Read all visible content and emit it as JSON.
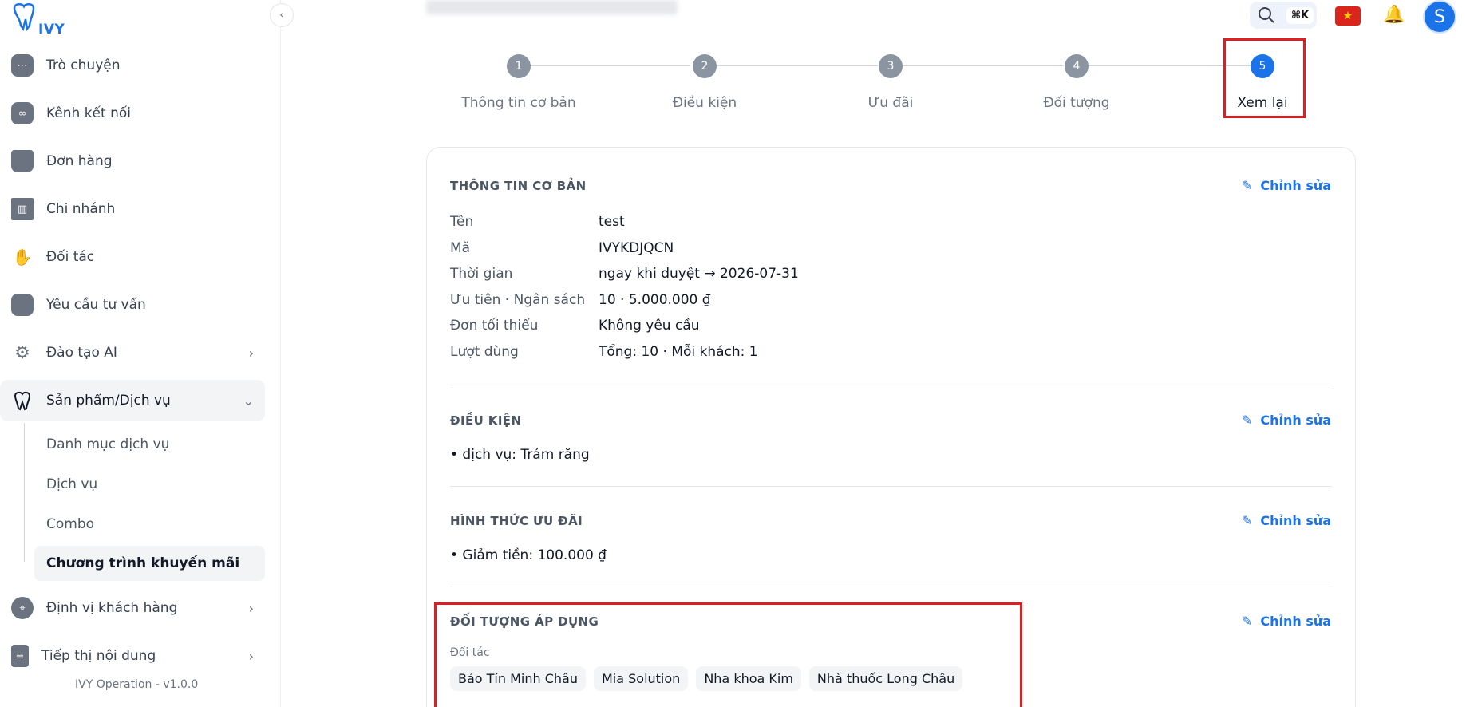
{
  "sidebar": {
    "logo_text": "IVY",
    "collapse_icon": "chevron-left-icon",
    "items": [
      {
        "label": "Trò chuyện",
        "icon": "chat-icon"
      },
      {
        "label": "Kênh kết nối",
        "icon": "link-icon"
      },
      {
        "label": "Đơn hàng",
        "icon": "bag-icon"
      },
      {
        "label": "Chi nhánh",
        "icon": "building-icon"
      },
      {
        "label": "Đối tác",
        "icon": "handshake-icon"
      },
      {
        "label": "Yêu cầu tư vấn",
        "icon": "inbox-icon"
      },
      {
        "label": "Đào tạo AI",
        "icon": "chip-icon"
      },
      {
        "label": "Sản phẩm/Dịch vụ",
        "icon": "tooth-icon"
      },
      {
        "label": "Định vị khách hàng",
        "icon": "target-icon"
      },
      {
        "label": "Tiếp thị nội dung",
        "icon": "document-icon"
      }
    ],
    "sub_items": [
      "Danh mục dịch vụ",
      "Dịch vụ",
      "Combo",
      "Chương trình khuyến mãi"
    ],
    "version": "IVY Operation - v1.0.0"
  },
  "topbar": {
    "shortcut": "⌘K",
    "avatar_letter": "S"
  },
  "stepper": {
    "steps": [
      {
        "number": "1",
        "label": "Thông tin cơ bản"
      },
      {
        "number": "2",
        "label": "Điều kiện"
      },
      {
        "number": "3",
        "label": "Ưu đãi"
      },
      {
        "number": "4",
        "label": "Đối tượng"
      },
      {
        "number": "5",
        "label": "Xem lại"
      }
    ],
    "current": 5
  },
  "review": {
    "edit_label": "Chỉnh sửa",
    "basic": {
      "title": "THÔNG TIN CƠ BẢN",
      "rows": [
        {
          "key": "Tên",
          "value": "test"
        },
        {
          "key": "Mã",
          "value": "IVYKDJQCN"
        },
        {
          "key": "Thời gian",
          "value": "ngay khi duyệt → 2026-07-31"
        },
        {
          "key": "Ưu tiên · Ngân sách",
          "value": "10 · 5.000.000 ₫"
        },
        {
          "key": "Đơn tối thiểu",
          "value": "Không yêu cầu"
        },
        {
          "key": "Lượt dùng",
          "value": "Tổng: 10 · Mỗi khách: 1"
        }
      ]
    },
    "conditions": {
      "title": "ĐIỀU KIỆN",
      "items": [
        "• dịch vụ: Trám răng"
      ]
    },
    "offer": {
      "title": "HÌNH THỨC ƯU ĐÃI",
      "items": [
        "• Giảm tiền: 100.000 ₫"
      ]
    },
    "targets": {
      "title": "ĐỐI TƯỢNG ÁP DỤNG",
      "caption": "Đối tác",
      "chips": [
        "Bảo Tín Minh Châu",
        "Mia Solution",
        "Nha khoa Kim",
        "Nhà thuốc Long Châu"
      ]
    }
  }
}
